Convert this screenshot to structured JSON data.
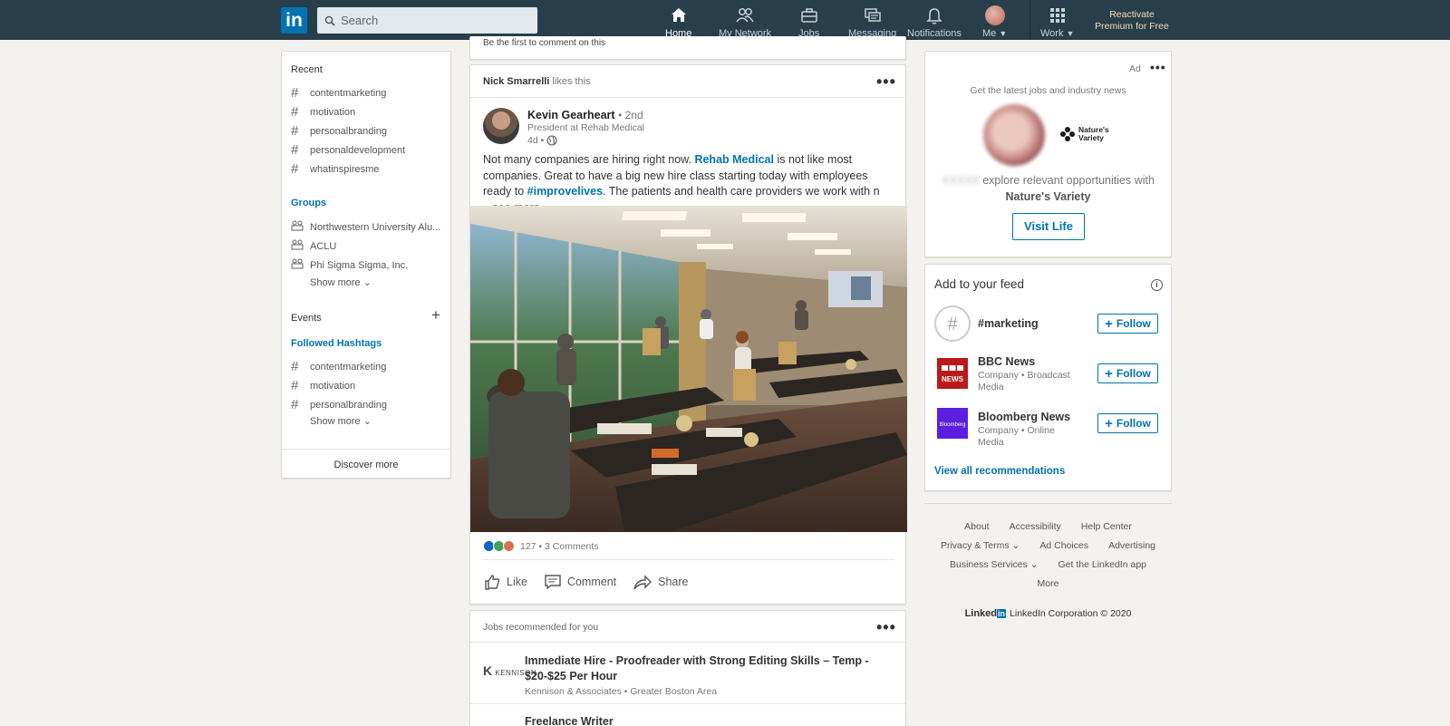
{
  "nav": {
    "logo": "in",
    "search_placeholder": "Search",
    "items": [
      {
        "label": "Home",
        "icon": "home-icon"
      },
      {
        "label": "My Network",
        "icon": "network-icon"
      },
      {
        "label": "Jobs",
        "icon": "briefcase-icon"
      },
      {
        "label": "Messaging",
        "icon": "messaging-icon"
      },
      {
        "label": "Notifications",
        "icon": "bell-icon"
      },
      {
        "label": "Me",
        "icon": "avatar"
      },
      {
        "label": "Work",
        "icon": "grid-icon"
      }
    ],
    "premium_line1": "Reactivate",
    "premium_line2": "Premium for Free"
  },
  "left": {
    "recent_title": "Recent",
    "recent": [
      "contentmarketing",
      "motivation",
      "personalbranding",
      "personaldevelopment",
      "whatinspiresme"
    ],
    "groups_title": "Groups",
    "groups": [
      "Northwestern University Alu...",
      "ACLU",
      "Phi Sigma Sigma, Inc."
    ],
    "show_more": "Show more",
    "events_title": "Events",
    "followed_title": "Followed Hashtags",
    "followed": [
      "contentmarketing",
      "motivation",
      "personalbranding"
    ],
    "discover": "Discover more"
  },
  "feed": {
    "top_strip": "Be the first to comment on this",
    "post": {
      "liker": "Nick Smarrelli",
      "liker_suffix": "likes this",
      "author": "Kevin Gearheart",
      "degree": "• 2nd",
      "title": "President at Rehab Medical",
      "time": "4d •",
      "text_1": "Not many companies are hiring right now. ",
      "link_1": "Rehab Medical",
      "text_2": " is not like most companies. Great to have a big new hire class starting today with employees ready to ",
      "link_2": "#improvelives",
      "text_3": ". The patients and health care providers we work with n",
      "see_more": " ...see more",
      "reactions": "127 • 3 Comments",
      "actions": [
        "Like",
        "Comment",
        "Share"
      ]
    },
    "jobs": {
      "header": "Jobs recommended for you",
      "logo_text": "KENNISON",
      "title": "Immediate Hire - Proofreader with Strong Editing Skills – Temp - $20-$25 Per Hour",
      "company": "Kennison & Associates • Greater Boston Area",
      "title_2": "Freelance Writer"
    }
  },
  "ad": {
    "label": "Ad",
    "tagline": "Get the latest jobs and industry news",
    "brand": "Nature's Variety",
    "name_blurred": "XXXXX",
    "text": "explore relevant opportunities with",
    "company": "Nature's Variety",
    "button": "Visit Life"
  },
  "add_feed": {
    "title": "Add to your feed",
    "items": [
      {
        "name": "#marketing",
        "sub": ""
      },
      {
        "name": "BBC News",
        "sub": "Company • Broadcast Media"
      },
      {
        "name": "Bloomberg News",
        "sub": "Company • Online Media"
      }
    ],
    "follow": "Follow",
    "view_all": "View all recommendations"
  },
  "footer": {
    "row1": [
      "About",
      "Accessibility",
      "Help Center"
    ],
    "row2": [
      "Privacy & Terms",
      "Ad Choices",
      "Advertising"
    ],
    "row3": [
      "Business Services",
      "Get the LinkedIn app"
    ],
    "more": "More",
    "brand": "Linked",
    "brand_in": "in",
    "copyright": "LinkedIn Corporation © 2020"
  },
  "colors": {
    "nav": "#283e4a",
    "accent": "#0073b1",
    "bbc": "#bb1919",
    "bloomberg": "#5b1fe0"
  }
}
